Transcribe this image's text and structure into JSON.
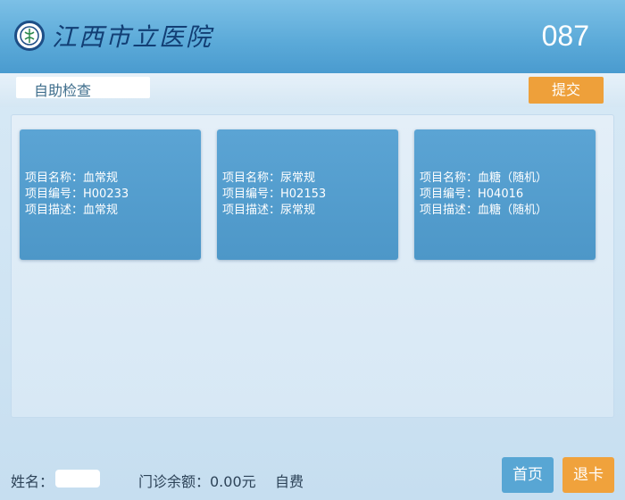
{
  "header": {
    "logo_text": "江西市立医院",
    "queue_number": "087"
  },
  "subbar": {
    "title": "自助检查",
    "submit_label": "提交"
  },
  "cards": [
    {
      "name": "项目名称：血常规",
      "code": "项目编号：H00233",
      "desc": "项目描述：血常规"
    },
    {
      "name": "项目名称：尿常规",
      "code": "项目编号：H02153",
      "desc": "项目描述：尿常规"
    },
    {
      "name": "项目名称：血糖（随机）",
      "code": "项目编号：H04016",
      "desc": "项目描述：血糖（随机）"
    }
  ],
  "footer": {
    "name_label": "姓名：",
    "balance": "门诊余额：0.00元",
    "payment_type": "自费",
    "home_label": "首页",
    "eject_card_label": "退卡"
  },
  "colors": {
    "header_blue": "#5aa9d8",
    "card_blue": "#4d97c8",
    "accent_orange": "#eea03a"
  }
}
